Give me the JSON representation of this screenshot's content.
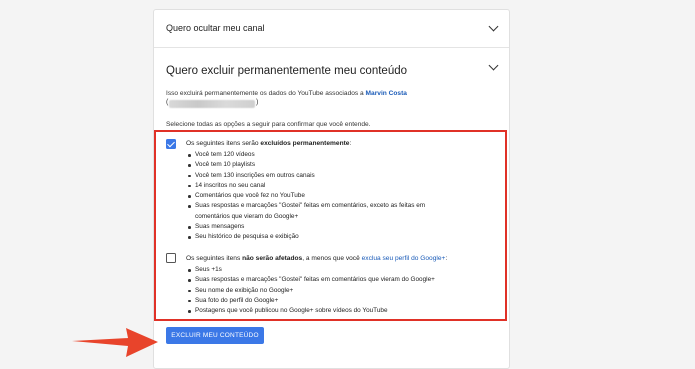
{
  "section_hide": {
    "title": "Quero ocultar meu canal"
  },
  "section_delete": {
    "title": "Quero excluir permanentemente meu conteúdo",
    "intro": "Isso excluirá permanentemente os dados do YouTube associados a",
    "account_name": "Marvin Costa",
    "confirm_prompt": "Selecione todas as opções a seguir para confirmar que você entende."
  },
  "group_deleted": {
    "checked": true,
    "head_prefix": "Os seguintes itens serão",
    "head_bold": "excluídos permanentemente",
    "head_suffix": ":",
    "items": [
      "Você tem 120 vídeos",
      "Você tem 10 playlists",
      "Você tem 130 inscrições em outros canais",
      "14 inscritos no seu canal",
      "Comentários que você fez no YouTube",
      "Suas respostas e marcações \"Gostei\" feitas em comentários, exceto as feitas em",
      "comentários que vieram do Google+",
      "Suas mensagens",
      "Seu histórico de pesquisa e exibição"
    ]
  },
  "group_unaffected": {
    "checked": false,
    "head_prefix": "Os seguintes itens",
    "head_bold": "não serão afetados",
    "head_middle": ", a menos que você",
    "head_link": "exclua seu perfil do Google+",
    "head_suffix": ":",
    "items": [
      "Seus +1s",
      "Suas respostas e marcações \"Gostei\" feitas em comentários que vieram do Google+",
      "Seu nome de exibição no Google+",
      "Sua foto do perfil do Google+",
      "Postagens que você publicou no Google+ sobre vídeos do YouTube"
    ]
  },
  "delete_button": {
    "label": "EXCLUIR MEU CONTEÚDO"
  },
  "colors": {
    "accent": "#3b78e7",
    "highlight": "#e03127",
    "link": "#1a5bb8"
  },
  "icons": {
    "collapse": "chevron-down-icon",
    "pointer": "arrow-right-icon"
  }
}
